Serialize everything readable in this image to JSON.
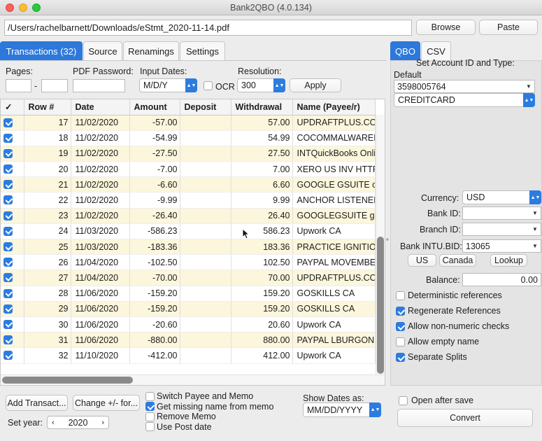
{
  "window": {
    "title": "Bank2QBO (4.0.134)"
  },
  "path": {
    "value": "/Users/rachelbarnett/Downloads/eStmt_2020-11-14.pdf"
  },
  "top_buttons": {
    "browse": "Browse",
    "paste": "Paste"
  },
  "tabs": [
    {
      "label": "Transactions (32)",
      "active": true
    },
    {
      "label": "Source"
    },
    {
      "label": "Renamings"
    },
    {
      "label": "Settings"
    }
  ],
  "toolbar": {
    "pages_label": "Pages:",
    "pages_dash": "-",
    "pdf_password_label": "PDF Password:",
    "input_dates_label": "Input Dates:",
    "input_dates_value": "M/D/Y",
    "ocr_label": "OCR",
    "resolution_label": "Resolution:",
    "resolution_value": "300",
    "apply": "Apply"
  },
  "table": {
    "columns": [
      "✓",
      "Row #",
      "Date",
      "Amount",
      "Deposit",
      "Withdrawal",
      "Name (Payee/r)"
    ],
    "rows": [
      {
        "row": "17",
        "date": "11/02/2020",
        "amount": "-57.00",
        "deposit": "",
        "withdrawal": "57.00",
        "name": "UPDRAFTPLUS.CON"
      },
      {
        "row": "18",
        "date": "11/02/2020",
        "amount": "-54.99",
        "deposit": "",
        "withdrawal": "54.99",
        "name": "COCOMMALWAREB"
      },
      {
        "row": "19",
        "date": "11/02/2020",
        "amount": "-27.50",
        "deposit": "",
        "withdrawal": "27.50",
        "name": "INTQuickBooks Onli"
      },
      {
        "row": "20",
        "date": "11/02/2020",
        "amount": "-7.00",
        "deposit": "",
        "withdrawal": "7.00",
        "name": "XERO US INV HTTP"
      },
      {
        "row": "21",
        "date": "11/02/2020",
        "amount": "-6.60",
        "deposit": "",
        "withdrawal": "6.60",
        "name": "GOOGLE GSUITE cc"
      },
      {
        "row": "22",
        "date": "11/02/2020",
        "amount": "-9.99",
        "deposit": "",
        "withdrawal": "9.99",
        "name": "ANCHOR LISTENER"
      },
      {
        "row": "23",
        "date": "11/02/2020",
        "amount": "-26.40",
        "deposit": "",
        "withdrawal": "26.40",
        "name": "GOOGLEGSUITE ge"
      },
      {
        "row": "24",
        "date": "11/03/2020",
        "amount": "-586.23",
        "deposit": "",
        "withdrawal": "586.23",
        "name": "Upwork CA"
      },
      {
        "row": "25",
        "date": "11/03/2020",
        "amount": "-183.36",
        "deposit": "",
        "withdrawal": "183.36",
        "name": "PRACTICE IGNITION"
      },
      {
        "row": "26",
        "date": "11/04/2020",
        "amount": "-102.50",
        "deposit": "",
        "withdrawal": "102.50",
        "name": "PAYPAL MOVEMBEF"
      },
      {
        "row": "27",
        "date": "11/04/2020",
        "amount": "-70.00",
        "deposit": "",
        "withdrawal": "70.00",
        "name": "UPDRAFTPLUS.CON"
      },
      {
        "row": "28",
        "date": "11/06/2020",
        "amount": "-159.20",
        "deposit": "",
        "withdrawal": "159.20",
        "name": "GOSKILLS CA"
      },
      {
        "row": "29",
        "date": "11/06/2020",
        "amount": "-159.20",
        "deposit": "",
        "withdrawal": "159.20",
        "name": "GOSKILLS CA"
      },
      {
        "row": "30",
        "date": "11/06/2020",
        "amount": "-20.60",
        "deposit": "",
        "withdrawal": "20.60",
        "name": "Upwork CA"
      },
      {
        "row": "31",
        "date": "11/06/2020",
        "amount": "-880.00",
        "deposit": "",
        "withdrawal": "880.00",
        "name": "PAYPAL LBURGONL"
      },
      {
        "row": "32",
        "date": "11/10/2020",
        "amount": "-412.00",
        "deposit": "",
        "withdrawal": "412.00",
        "name": "Upwork CA"
      }
    ]
  },
  "bottom": {
    "add_transaction": "Add Transact...",
    "change_sign": "Change +/- for...",
    "set_year_label": "Set year:",
    "year": "2020",
    "options": [
      {
        "label": "Switch Payee and Memo",
        "checked": false
      },
      {
        "label": "Get missing name from memo",
        "checked": true
      },
      {
        "label": "Remove Memo",
        "checked": false
      },
      {
        "label": "Use Post date",
        "checked": false
      }
    ],
    "show_dates_label": "Show Dates as:",
    "show_dates_value": "MM/DD/YYYY"
  },
  "right": {
    "tabs": [
      {
        "label": "QBO",
        "active": true
      },
      {
        "label": "CSV"
      }
    ],
    "heading": "Set Account ID and Type:",
    "default_label": "Default",
    "account_id": "3598005764",
    "account_type": "CREDITCARD",
    "currency_label": "Currency:",
    "currency_value": "USD",
    "bank_id_label": "Bank ID:",
    "bank_id_value": "",
    "branch_id_label": "Branch ID:",
    "branch_id_value": "",
    "intu_bid_label": "Bank INTU.BID:",
    "intu_bid_value": "13065",
    "us_button": "US",
    "canada_button": "Canada",
    "lookup_button": "Lookup",
    "balance_label": "Balance:",
    "balance_value": "0.00",
    "options": [
      {
        "label": "Deterministic references",
        "checked": false
      },
      {
        "label": "Regenerate References",
        "checked": true
      },
      {
        "label": "Allow non-numeric checks",
        "checked": true
      },
      {
        "label": "Allow empty name",
        "checked": false
      },
      {
        "label": "Separate Splits",
        "checked": true
      }
    ],
    "open_after_save": "Open after save",
    "convert": "Convert"
  }
}
